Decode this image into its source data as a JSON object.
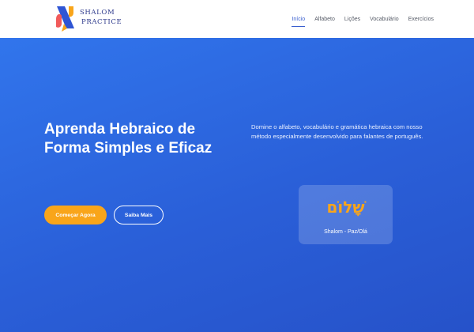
{
  "brand": {
    "logo_line1": "SHALOM",
    "logo_line2": "PRACTICE"
  },
  "nav": {
    "items": [
      {
        "label": "Início",
        "active": true
      },
      {
        "label": "Alfabeto",
        "active": false
      },
      {
        "label": "Lições",
        "active": false
      },
      {
        "label": "Vocabulário",
        "active": false
      },
      {
        "label": "Exercícios",
        "active": false
      }
    ]
  },
  "hero": {
    "headline_line1": "Aprenda Hebraico de",
    "headline_line2": "Forma Simples e Eficaz",
    "subtext": "Domine o alfabeto, vocabulário e gramática hebraica com nosso método especialmente desenvolvido para falantes de português.",
    "primary_button": "Começar Agora",
    "secondary_button": "Saiba Mais"
  },
  "card": {
    "hebrew": "שָׁלוֹם",
    "caption": "Shalom - Paz/Olá"
  },
  "colors": {
    "accent": "#f9a51a",
    "brand_blue": "#2d6be4",
    "nav_active": "#3a5fcf",
    "logo_text": "#2e3a8c"
  }
}
